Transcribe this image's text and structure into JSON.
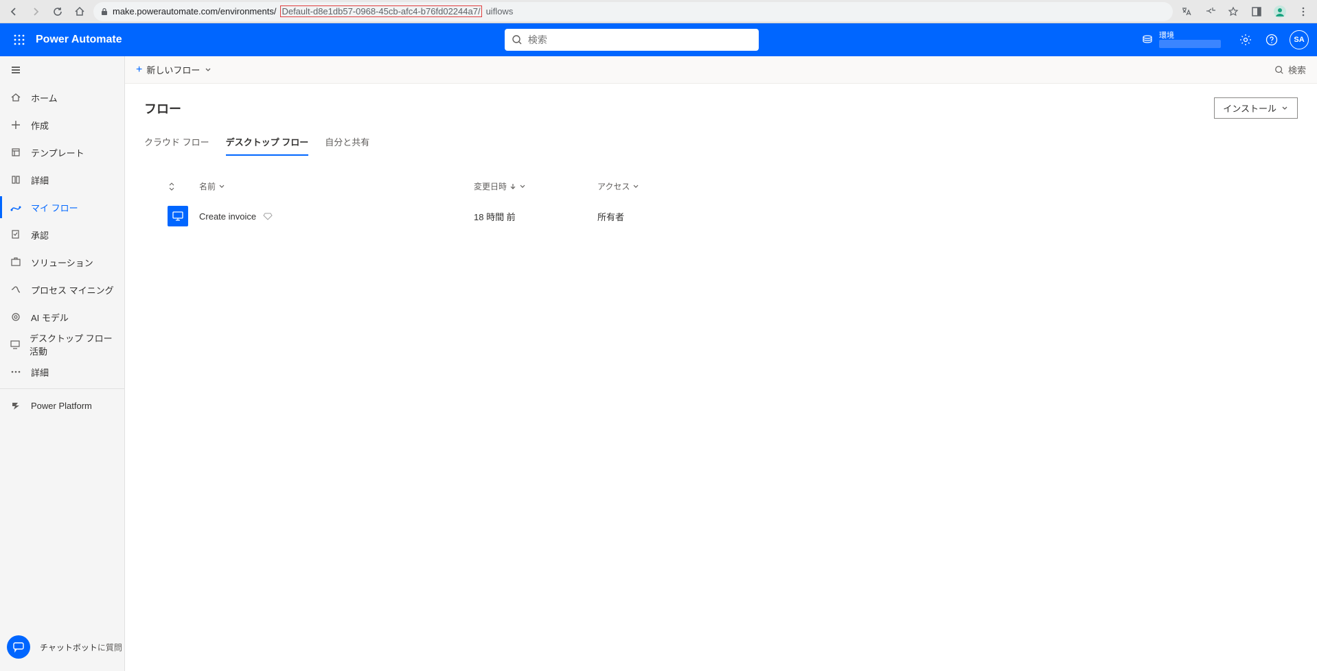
{
  "browser": {
    "url_pre": "make.powerautomate.com/environments/",
    "url_highlight": "Default-d8e1db57-0968-45cb-afc4-b76fd02244a7/",
    "url_post": "uiflows"
  },
  "header": {
    "app_name": "Power Automate",
    "search_placeholder": "検索",
    "env_label": "環境",
    "avatar_initials": "SA"
  },
  "sidebar": {
    "items": [
      {
        "label": "ホーム"
      },
      {
        "label": "作成"
      },
      {
        "label": "テンプレート"
      },
      {
        "label": "詳細"
      },
      {
        "label": "マイ フロー"
      },
      {
        "label": "承認"
      },
      {
        "label": "ソリューション"
      },
      {
        "label": "プロセス マイニング"
      },
      {
        "label": "AI モデル"
      },
      {
        "label": "デスクトップ フロー活動"
      },
      {
        "label": "詳細"
      },
      {
        "label": "Power Platform"
      }
    ],
    "chatbot_pre": "チャットボット",
    "chatbot_post": "に質問"
  },
  "cmd": {
    "new_flow": "新しいフロー",
    "search": "検索"
  },
  "page": {
    "title": "フロー",
    "install_btn": "インストール",
    "tabs": [
      {
        "label": "クラウド フロー"
      },
      {
        "label": "デスクトップ フロー"
      },
      {
        "label": "自分と共有"
      }
    ]
  },
  "table": {
    "col_name": "名前",
    "col_modified": "変更日時",
    "col_access": "アクセス",
    "rows": [
      {
        "name": "Create invoice",
        "modified": "18 時間 前",
        "access": "所有者"
      }
    ]
  }
}
